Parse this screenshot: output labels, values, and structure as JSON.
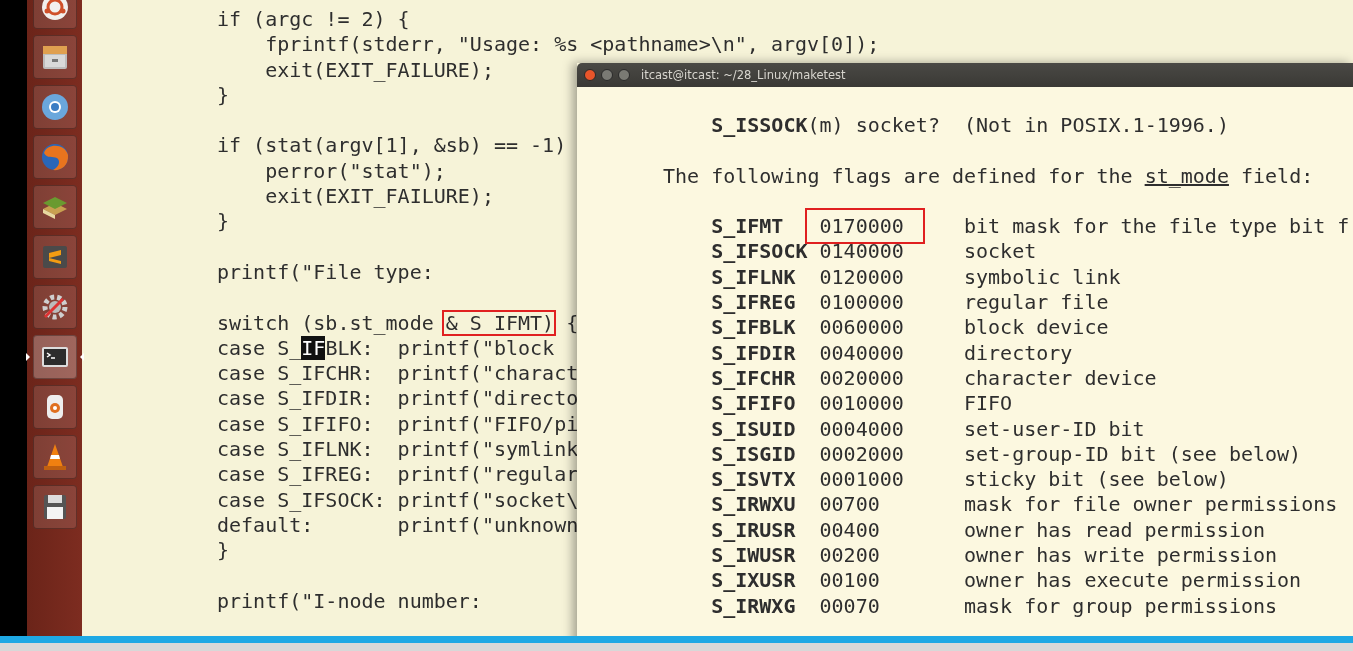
{
  "launcher": {
    "items": [
      {
        "kind": "dash",
        "selected": false
      },
      {
        "kind": "files",
        "selected": false
      },
      {
        "kind": "chromium",
        "selected": false
      },
      {
        "kind": "firefox",
        "selected": false
      },
      {
        "kind": "books",
        "selected": false
      },
      {
        "kind": "sublime",
        "selected": false
      },
      {
        "kind": "settings",
        "selected": false
      },
      {
        "kind": "terminal",
        "selected": true
      },
      {
        "kind": "speaker",
        "selected": false
      },
      {
        "kind": "cone",
        "selected": false
      },
      {
        "kind": "disk",
        "selected": false
      }
    ]
  },
  "editor": {
    "lines": [
      {
        "kind": "code",
        "text": "if (argc != 2) {"
      },
      {
        "kind": "code",
        "text": "    fprintf(stderr, \"Usage: %s <pathname>\\n\", argv[0]);"
      },
      {
        "kind": "code",
        "text": "    exit(EXIT_FAILURE);"
      },
      {
        "kind": "code",
        "text": "}"
      },
      {
        "kind": "blank"
      },
      {
        "kind": "code",
        "text": "if (stat(argv[1], &sb) == -1)"
      },
      {
        "kind": "code",
        "text": "    perror(\"stat\");"
      },
      {
        "kind": "code",
        "text": "    exit(EXIT_FAILURE);"
      },
      {
        "kind": "code",
        "text": "}"
      },
      {
        "kind": "blank"
      },
      {
        "kind": "code",
        "text": "printf(\"File type:"
      },
      {
        "kind": "blank"
      },
      {
        "kind": "parts",
        "parts": [
          {
            "text": "switch (sb.st_mode ",
            "selected": false,
            "boxed": false
          },
          {
            "text": "& S_IFMT)",
            "selected": false,
            "boxed": true
          },
          {
            "text": " {",
            "selected": false,
            "boxed": false
          }
        ]
      },
      {
        "kind": "parts",
        "parts": [
          {
            "text": "case S_",
            "selected": false,
            "boxed": false
          },
          {
            "text": "IF",
            "selected": true,
            "boxed": false
          },
          {
            "text": "BLK:  printf(\"block",
            "selected": false,
            "boxed": false
          }
        ]
      },
      {
        "kind": "code",
        "text": "case S_IFCHR:  printf(\"charact"
      },
      {
        "kind": "code",
        "text": "case S_IFDIR:  printf(\"directo"
      },
      {
        "kind": "code",
        "text": "case S_IFIFO:  printf(\"FIFO/pi"
      },
      {
        "kind": "code",
        "text": "case S_IFLNK:  printf(\"symlink"
      },
      {
        "kind": "code",
        "text": "case S_IFREG:  printf(\"regular"
      },
      {
        "kind": "code",
        "text": "case S_IFSOCK: printf(\"socket\\"
      },
      {
        "kind": "code",
        "text": "default:       printf(\"unknown"
      },
      {
        "kind": "code",
        "text": "}"
      },
      {
        "kind": "blank"
      },
      {
        "kind": "code",
        "text": "printf(\"I-node number:"
      }
    ]
  },
  "terminal": {
    "title": "itcast@itcast: ~/28_Linux/maketest",
    "macro_line": "**S_ISSOCK**(m) socket?  (Not in POSIX.1-1996.)",
    "intro": {
      "before": "The following flags are defined for the ",
      "underlined": "st_mode",
      "after": " field:"
    },
    "rows": [
      {
        "name": "S_IFMT",
        "value": "0170000",
        "description": "bit mask for the file type bit f",
        "boxed": true
      },
      {
        "name": "S_IFSOCK",
        "value": "0140000",
        "description": "socket",
        "boxed": false
      },
      {
        "name": "S_IFLNK",
        "value": "0120000",
        "description": "symbolic link",
        "boxed": false
      },
      {
        "name": "S_IFREG",
        "value": "0100000",
        "description": "regular file",
        "boxed": false
      },
      {
        "name": "S_IFBLK",
        "value": "0060000",
        "description": "block device",
        "boxed": false
      },
      {
        "name": "S_IFDIR",
        "value": "0040000",
        "description": "directory",
        "boxed": false
      },
      {
        "name": "S_IFCHR",
        "value": "0020000",
        "description": "character device",
        "boxed": false
      },
      {
        "name": "S_IFIFO",
        "value": "0010000",
        "description": "FIFO",
        "boxed": false
      },
      {
        "name": "S_ISUID",
        "value": "0004000",
        "description": "set-user-ID bit",
        "boxed": false
      },
      {
        "name": "S_ISGID",
        "value": "0002000",
        "description": "set-group-ID bit (see below)",
        "boxed": false
      },
      {
        "name": "S_ISVTX",
        "value": "0001000",
        "description": "sticky bit (see below)",
        "boxed": false
      },
      {
        "name": "S_IRWXU",
        "value": "00700",
        "description": "mask for file owner permissions",
        "boxed": false
      },
      {
        "name": "S_IRUSR",
        "value": "00400",
        "description": "owner has read permission",
        "boxed": false
      },
      {
        "name": "S_IWUSR",
        "value": "00200",
        "description": "owner has write permission",
        "boxed": false
      },
      {
        "name": "S_IXUSR",
        "value": "00100",
        "description": "owner has execute permission",
        "boxed": false
      },
      {
        "name": "S_IRWXG",
        "value": "00070",
        "description": "mask for group permissions",
        "boxed": false
      }
    ]
  },
  "video_progress": {
    "level": 1
  }
}
